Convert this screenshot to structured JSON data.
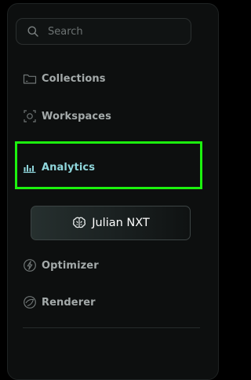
{
  "search": {
    "placeholder": "Search"
  },
  "nav": {
    "collections": {
      "label": "Collections",
      "icon": "folder-icon"
    },
    "workspaces": {
      "label": "Workspaces",
      "icon": "workspace-icon"
    },
    "analytics": {
      "label": "Analytics",
      "icon": "bar-chart-icon",
      "active": true
    },
    "optimizer": {
      "label": "Optimizer",
      "icon": "lightning-icon"
    },
    "renderer": {
      "label": "Renderer",
      "icon": "shield-icon"
    }
  },
  "cta": {
    "label": "Julian NXT",
    "icon": "brain-icon"
  },
  "colors": {
    "background": "#000000",
    "panel": "#0d0f0f",
    "text": "#a4aaaa",
    "active_text": "#8fd6db",
    "highlight": "#1cf20e"
  }
}
